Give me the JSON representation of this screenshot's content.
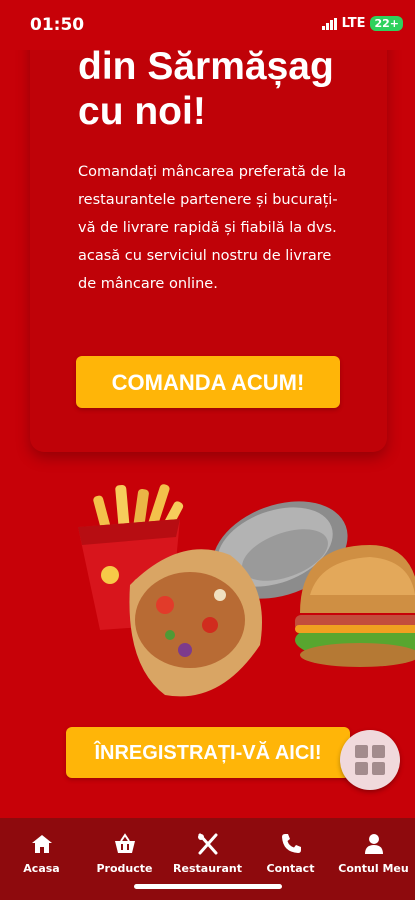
{
  "status_bar": {
    "time": "01:50",
    "network": "LTE",
    "battery": "22+"
  },
  "hero": {
    "title_line1": "din Sărmășag",
    "title_line2": "cu noi!",
    "description": "Comandați mâncarea preferată de la restaurantele partenere și bucurați-vă de livrare rapidă și fiabilă la dvs. acasă cu serviciul nostru de livrare de mâncare online.",
    "order_button": "COMANDA ACUM!"
  },
  "register_button": "ÎNREGISTRAȚI-VĂ AICI!",
  "bottom_nav": {
    "items": [
      {
        "label": "Acasa",
        "icon": "home-icon"
      },
      {
        "label": "Producte",
        "icon": "basket-icon"
      },
      {
        "label": "Restaurant",
        "icon": "cutlery-icon"
      },
      {
        "label": "Contact",
        "icon": "phone-icon"
      },
      {
        "label": "Contul Meu",
        "icon": "user-icon"
      }
    ]
  },
  "colors": {
    "background": "#c70108",
    "accent": "#ffb508",
    "nav": "#8e0a0d"
  }
}
